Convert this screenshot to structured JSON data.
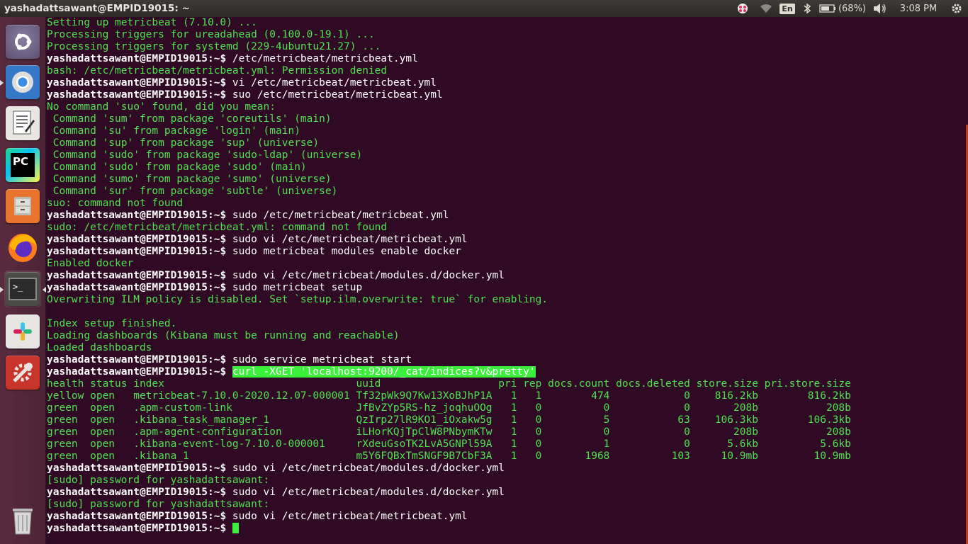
{
  "panel": {
    "window_title": "yashadattsawant@EMPID19015: ~",
    "language": "En",
    "battery": "(68%)",
    "clock": "3:08 PM"
  },
  "launcher": {
    "items": [
      {
        "name": "ubuntu-dash",
        "icon": "ubuntu-logo-icon"
      },
      {
        "name": "chrome",
        "icon": "chrome-icon"
      },
      {
        "name": "text-editor",
        "icon": "text-editor-icon"
      },
      {
        "name": "pycharm",
        "icon": "pycharm-icon",
        "label": "PC"
      },
      {
        "name": "files",
        "icon": "file-cabinet-icon"
      },
      {
        "name": "firefox",
        "icon": "firefox-icon"
      },
      {
        "name": "terminal",
        "icon": "terminal-icon"
      },
      {
        "name": "slack",
        "icon": "slack-icon"
      },
      {
        "name": "system-settings",
        "icon": "settings-wrench-icon"
      },
      {
        "name": "trash",
        "icon": "trash-icon"
      }
    ]
  },
  "terminal": {
    "user": "yashadattsawant@EMPID19015",
    "lines": [
      {
        "t": "Setting up metricbeat (7.10.0) ...",
        "g": true
      },
      {
        "t": "Processing triggers for ureadahead (0.100.0-19.1) ...",
        "g": true
      },
      {
        "t": "Processing triggers for systemd (229-4ubuntu21.27) ...",
        "g": true
      },
      {
        "p": true,
        "cmd": "/etc/metricbeat/metricbeat.yml"
      },
      {
        "t": "bash: /etc/metricbeat/metricbeat.yml: Permission denied",
        "g": true
      },
      {
        "p": true,
        "cmd": "vi /etc/metricbeat/metricbeat.yml"
      },
      {
        "p": true,
        "cmd": "suo /etc/metricbeat/metricbeat.yml"
      },
      {
        "t": "No command 'suo' found, did you mean:",
        "g": true
      },
      {
        "t": " Command 'sum' from package 'coreutils' (main)",
        "g": true
      },
      {
        "t": " Command 'su' from package 'login' (main)",
        "g": true
      },
      {
        "t": " Command 'sup' from package 'sup' (universe)",
        "g": true
      },
      {
        "t": " Command 'sudo' from package 'sudo-ldap' (universe)",
        "g": true
      },
      {
        "t": " Command 'sudo' from package 'sudo' (main)",
        "g": true
      },
      {
        "t": " Command 'sumo' from package 'sumo' (universe)",
        "g": true
      },
      {
        "t": " Command 'sur' from package 'subtle' (universe)",
        "g": true
      },
      {
        "t": "suo: command not found",
        "g": true
      },
      {
        "p": true,
        "cmd": "sudo /etc/metricbeat/metricbeat.yml"
      },
      {
        "t": "sudo: /etc/metricbeat/metricbeat.yml: command not found",
        "g": true
      },
      {
        "p": true,
        "cmd": "sudo vi /etc/metricbeat/metricbeat.yml"
      },
      {
        "p": true,
        "cmd": "sudo metricbeat modules enable docker"
      },
      {
        "t": "Enabled docker",
        "g": true
      },
      {
        "p": true,
        "cmd": "sudo vi /etc/metricbeat/modules.d/docker.yml"
      },
      {
        "p": true,
        "cmd": "sudo metricbeat setup"
      },
      {
        "t": "Overwriting ILM policy is disabled. Set `setup.ilm.overwrite: true` for enabling.",
        "g": true
      },
      {
        "t": "",
        "g": true
      },
      {
        "t": "Index setup finished.",
        "g": true
      },
      {
        "t": "Loading dashboards (Kibana must be running and reachable)",
        "g": true
      },
      {
        "t": "Loaded dashboards",
        "g": true
      },
      {
        "p": true,
        "cmd": "sudo service metricbeat start"
      },
      {
        "p": true,
        "cmd": "curl -XGET 'localhost:9200/_cat/indices?v&pretty'",
        "hl": true
      },
      {
        "t": "health status index                               uuid                   pri rep docs.count docs.deleted store.size pri.store.size",
        "g": true
      },
      {
        "t": "yellow open   metricbeat-7.10.0-2020.12.07-000001 Tf32pWk9Q7Kw13XoBJhP1A   1   1        474            0    816.2kb        816.2kb",
        "g": true
      },
      {
        "t": "green  open   .apm-custom-link                    JfBvZYp5RS-hz_joqhuOOg   1   0          0            0       208b           208b",
        "g": true
      },
      {
        "t": "green  open   .kibana_task_manager_1              QzIrp27lR9KO1_iOxakw5g   1   0          5           63    106.3kb        106.3kb",
        "g": true
      },
      {
        "t": "green  open   .apm-agent-configuration            iLHorKQjTpClW8PNbymKTw   1   0          0            0       208b           208b",
        "g": true
      },
      {
        "t": "green  open   .kibana-event-log-7.10.0-000001     rXdeuGsoTK2LvA5GNPl59A   1   0          1            0      5.6kb          5.6kb",
        "g": true
      },
      {
        "t": "green  open   .kibana_1                           m5Y6FQBxTmSNGF9B7CbF3A   1   0       1968          103     10.9mb         10.9mb",
        "g": true
      },
      {
        "p": true,
        "cmd": "sudo vi /etc/metricbeat/modules.d/docker.yml"
      },
      {
        "t": "[sudo] password for yashadattsawant:",
        "g": true
      },
      {
        "p": true,
        "cmd": "sudo vi /etc/metricbeat/modules.d/docker.yml"
      },
      {
        "t": "[sudo] password for yashadattsawant:",
        "g": true
      },
      {
        "p": true,
        "cmd": "sudo vi /etc/metricbeat/metricbeat.yml"
      },
      {
        "p": true,
        "cmd": "",
        "cursor": true
      }
    ]
  },
  "colors": {
    "terminal_bg": "#300a24",
    "output_green": "#4fe24f",
    "highlight": "#3bf03b",
    "panel_bg": "#3c3b37"
  }
}
